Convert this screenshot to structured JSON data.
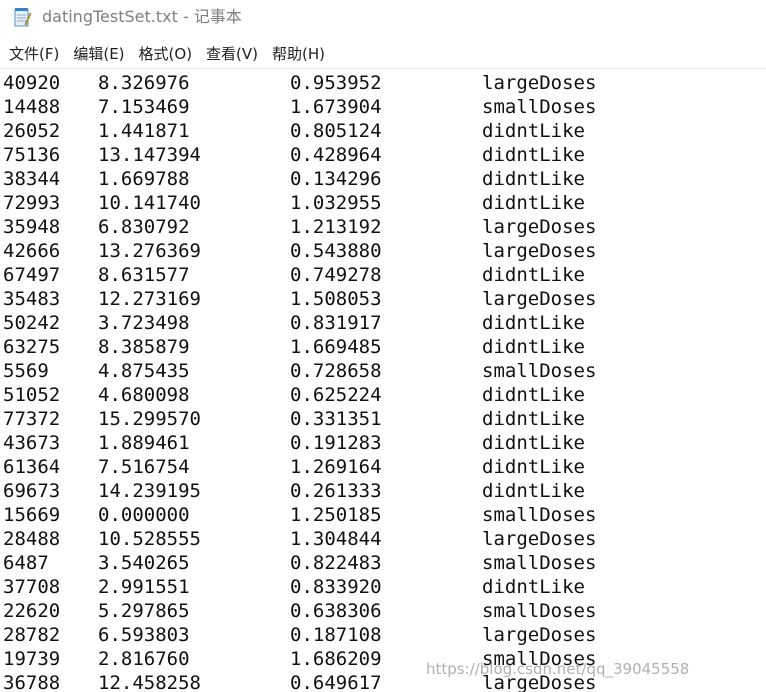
{
  "window": {
    "title": "datingTestSet.txt - 记事本",
    "icon": "notepad-icon"
  },
  "menu": [
    {
      "label": "文件(F)"
    },
    {
      "label": "编辑(E)"
    },
    {
      "label": "格式(O)"
    },
    {
      "label": "查看(V)"
    },
    {
      "label": "帮助(H)"
    }
  ],
  "rows": [
    [
      "40920",
      "8.326976",
      "0.953952",
      "largeDoses"
    ],
    [
      "14488",
      "7.153469",
      "1.673904",
      "smallDoses"
    ],
    [
      "26052",
      "1.441871",
      "0.805124",
      "didntLike"
    ],
    [
      "75136",
      "13.147394",
      "0.428964",
      "didntLike"
    ],
    [
      "38344",
      "1.669788",
      "0.134296",
      "didntLike"
    ],
    [
      "72993",
      "10.141740",
      "1.032955",
      "didntLike"
    ],
    [
      "35948",
      "6.830792",
      "1.213192",
      "largeDoses"
    ],
    [
      "42666",
      "13.276369",
      "0.543880",
      "largeDoses"
    ],
    [
      "67497",
      "8.631577",
      "0.749278",
      "didntLike"
    ],
    [
      "35483",
      "12.273169",
      "1.508053",
      "largeDoses"
    ],
    [
      "50242",
      "3.723498",
      "0.831917",
      "didntLike"
    ],
    [
      "63275",
      "8.385879",
      "1.669485",
      "didntLike"
    ],
    [
      "5569",
      "4.875435",
      "0.728658",
      "smallDoses"
    ],
    [
      "51052",
      "4.680098",
      "0.625224",
      "didntLike"
    ],
    [
      "77372",
      "15.299570",
      "0.331351",
      "didntLike"
    ],
    [
      "43673",
      "1.889461",
      "0.191283",
      "didntLike"
    ],
    [
      "61364",
      "7.516754",
      "1.269164",
      "didntLike"
    ],
    [
      "69673",
      "14.239195",
      "0.261333",
      "didntLike"
    ],
    [
      "15669",
      "0.000000",
      "1.250185",
      "smallDoses"
    ],
    [
      "28488",
      "10.528555",
      "1.304844",
      "largeDoses"
    ],
    [
      "6487",
      "3.540265",
      "0.822483",
      "smallDoses"
    ],
    [
      "37708",
      "2.991551",
      "0.833920",
      "didntLike"
    ],
    [
      "22620",
      "5.297865",
      "0.638306",
      "smallDoses"
    ],
    [
      "28782",
      "6.593803",
      "0.187108",
      "largeDoses"
    ],
    [
      "19739",
      "2.816760",
      "1.686209",
      "smallDoses"
    ],
    [
      "36788",
      "12.458258",
      "0.649617",
      "largeDoses"
    ]
  ],
  "watermark": "https://blog.csdn.net/qq_39045558"
}
